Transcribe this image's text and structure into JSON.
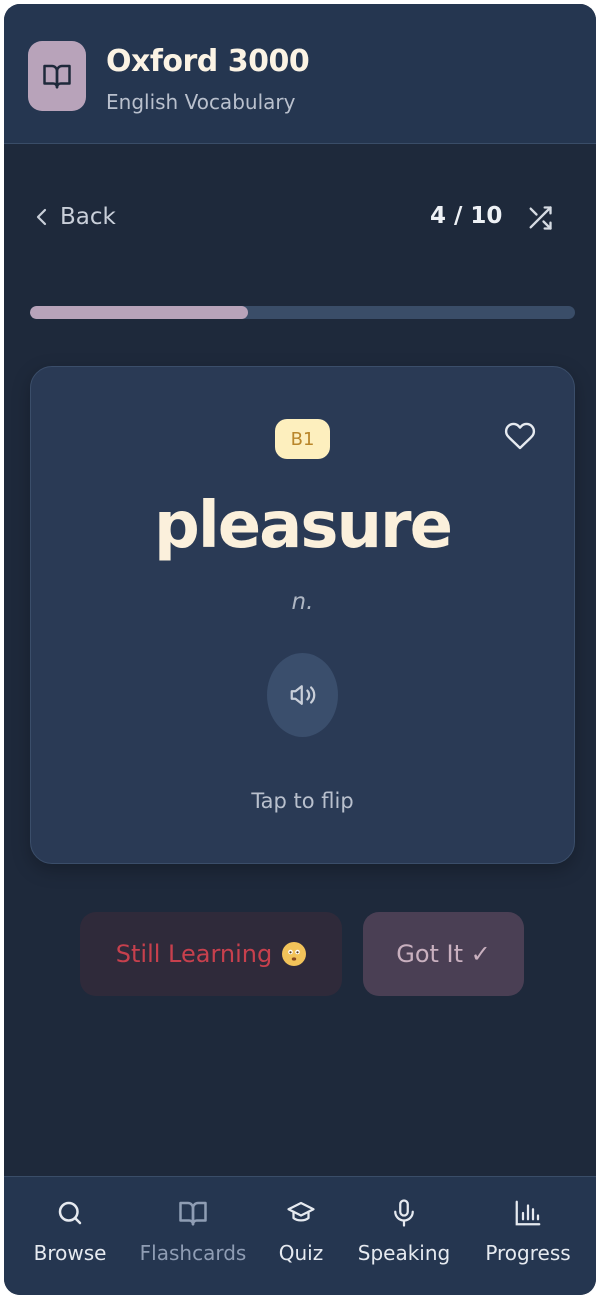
{
  "header": {
    "title": "Oxford 3000",
    "subtitle": "English Vocabulary",
    "logo_icon": "book-icon"
  },
  "nav": {
    "back_label": "Back",
    "counter": "4 / 10",
    "shuffle_icon": "shuffle-icon"
  },
  "progress": {
    "current": 4,
    "total": 10,
    "fraction": 0.4
  },
  "card": {
    "level": "B1",
    "word": "pleasure",
    "part_of_speech": "n.",
    "hint": "Tap to flip",
    "favorite_icon": "heart-icon",
    "audio_icon": "speaker-icon"
  },
  "actions": {
    "still_learning_label": "Still Learning",
    "got_it_label": "Got It ✓"
  },
  "tabs": [
    {
      "label": "Browse",
      "icon": "search-icon",
      "active": false
    },
    {
      "label": "Flashcards",
      "icon": "book-icon",
      "active": true
    },
    {
      "label": "Quiz",
      "icon": "graduation-cap-icon",
      "active": false
    },
    {
      "label": "Speaking",
      "icon": "microphone-icon",
      "active": false
    },
    {
      "label": "Progress",
      "icon": "bar-chart-icon",
      "active": false
    }
  ],
  "colors": {
    "background": "#1e293b",
    "header": "#253650",
    "accent": "#b8a3ba",
    "word": "#fbf0dc",
    "badge_bg": "#fdefbe",
    "still_learning_text": "#c7404d"
  }
}
